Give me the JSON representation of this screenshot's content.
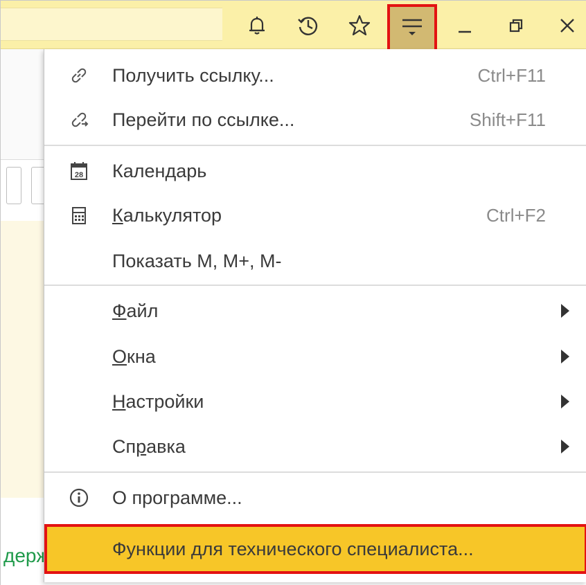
{
  "toolbar": {
    "buttons": [
      {
        "name": "bell-icon"
      },
      {
        "name": "history-icon"
      },
      {
        "name": "star-icon"
      },
      {
        "name": "menu-icon"
      },
      {
        "name": "minimize-icon"
      },
      {
        "name": "restore-icon"
      },
      {
        "name": "close-icon"
      }
    ]
  },
  "background": {
    "partial_text": "держ"
  },
  "menu": {
    "get_link": {
      "label": "Получить ссылку...",
      "shortcut": "Ctrl+F11",
      "icon": "link-icon"
    },
    "go_link": {
      "label": "Перейти по ссылке...",
      "shortcut": "Shift+F11",
      "icon": "link-go-icon"
    },
    "calendar": {
      "label_a": "Кален",
      "label_u": "д",
      "label_b": "арь",
      "icon": "calendar-icon",
      "icon_text": "28"
    },
    "calculator": {
      "label_u": "К",
      "label_b": "алькулятор",
      "shortcut": "Ctrl+F2",
      "icon": "calculator-icon"
    },
    "show_m": {
      "label": "Показать M, M+, M-"
    },
    "file": {
      "label_u": "Ф",
      "label_b": "айл"
    },
    "windows": {
      "label_u": "О",
      "label_b": "кна"
    },
    "settings": {
      "label_u": "Н",
      "label_b": "астройки"
    },
    "help": {
      "label_a": "Сп",
      "label_u": "р",
      "label_b": "авка"
    },
    "about": {
      "label": "О программе...",
      "icon": "info-icon"
    },
    "tech": {
      "label": "Функции для технического специалиста..."
    }
  },
  "colors": {
    "toolbar_bg": "#fbf0a8",
    "highlight_bg": "#f7c628",
    "highlight_border": "#e31212"
  }
}
